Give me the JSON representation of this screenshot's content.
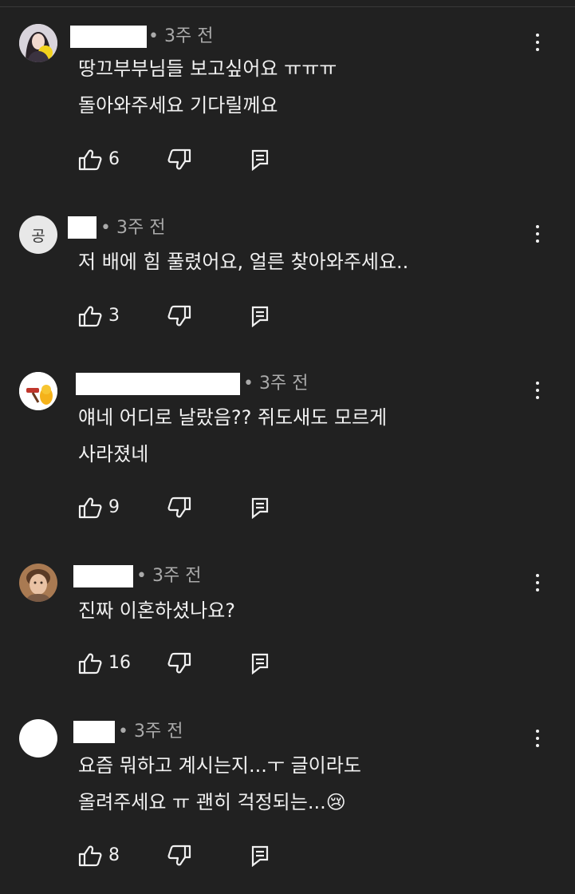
{
  "comments": [
    {
      "avatar": "cartoon-avatar",
      "avatar_letter": "",
      "time": "• 3주 전",
      "lines": [
        "땅끄부부님들 보고싶어요 ㅠㅠㅠ",
        "돌아와주세요 기다릴께요"
      ],
      "likes": "6"
    },
    {
      "avatar": "letter-avatar",
      "avatar_letter": "공",
      "time": "• 3주 전",
      "lines": [
        "저 배에 힘 풀렸어요, 얼른 찾아와주세요.."
      ],
      "likes": "3"
    },
    {
      "avatar": "emoji-avatar",
      "avatar_letter": "",
      "time": "• 3주 전",
      "lines": [
        "얘네 어디로 날랐음?? 쥐도새도 모르게",
        "사라졌네"
      ],
      "likes": "9"
    },
    {
      "avatar": "photo-avatar",
      "avatar_letter": "",
      "time": "• 3주 전",
      "lines": [
        "진짜 이혼하셨나요?"
      ],
      "likes": "16"
    },
    {
      "avatar": "blank-avatar",
      "avatar_letter": "",
      "time": "• 3주 전",
      "lines": [
        "요즘 뭐하고 계시는지...ㅜ 글이라도",
        "올려주세요 ㅠ 괜히 걱정되는...😢"
      ],
      "likes": "8"
    }
  ],
  "icons": {
    "like": "thumb-up-icon",
    "dislike": "thumb-down-icon",
    "reply": "reply-icon",
    "menu": "more-vert-icon"
  },
  "colors": {
    "background": "#212121",
    "text": "#f1f1f1",
    "meta": "#aaaaaa"
  }
}
